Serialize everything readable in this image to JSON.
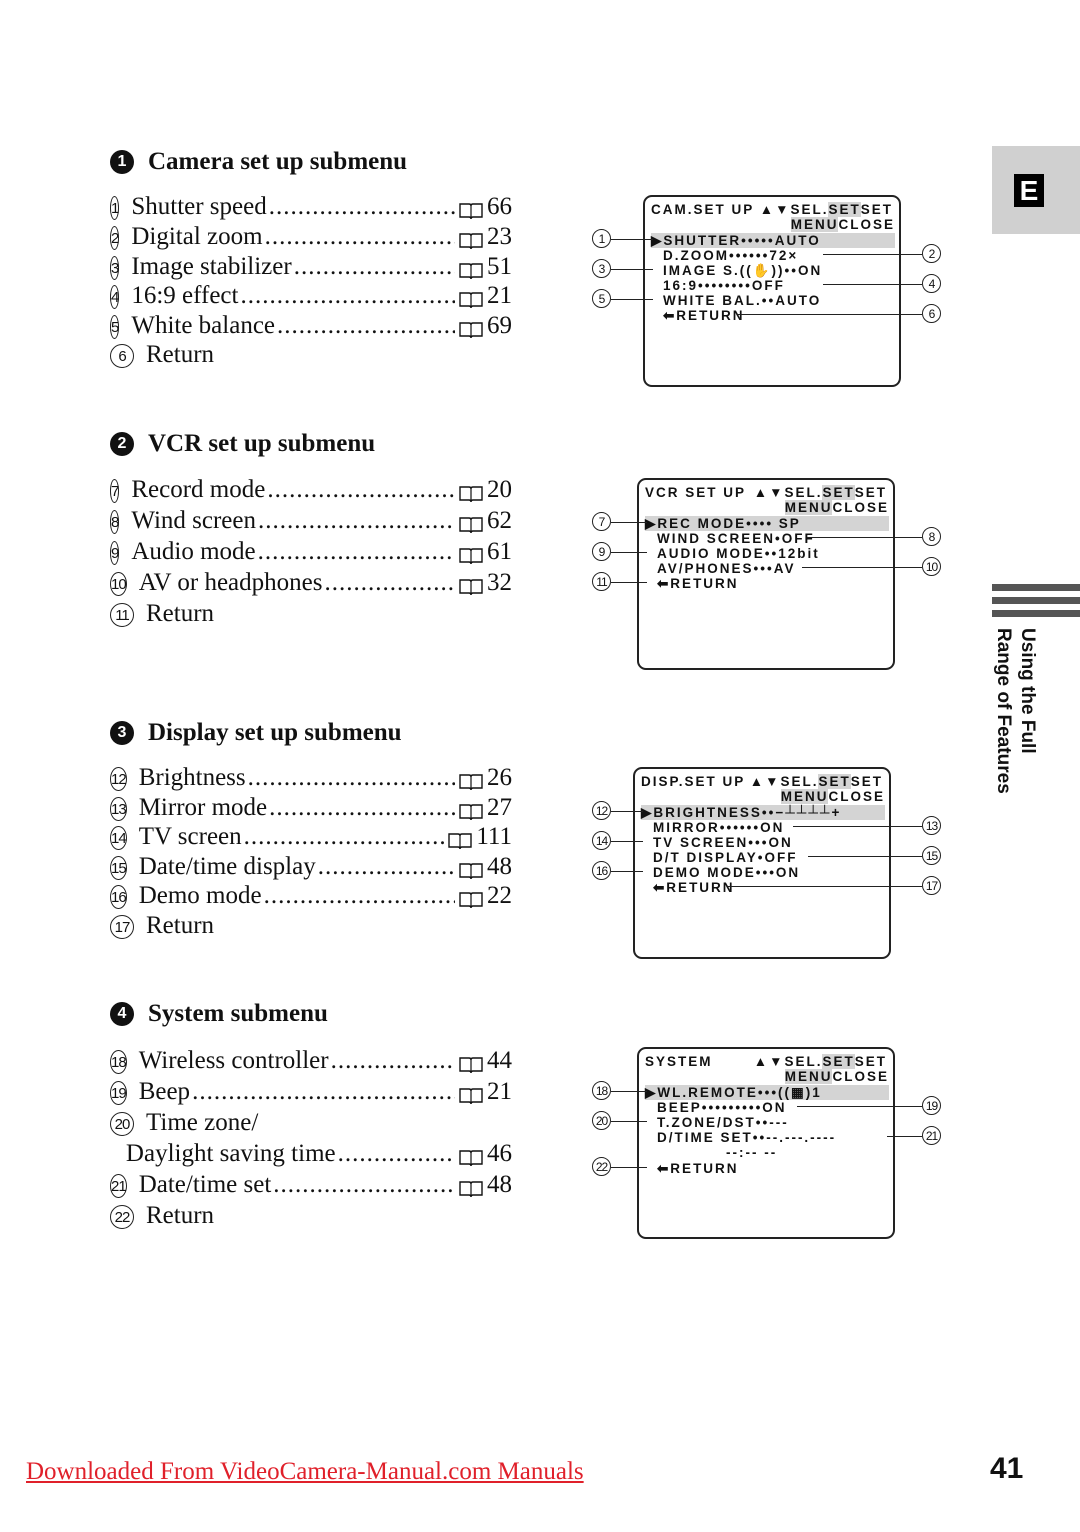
{
  "sections": [
    {
      "bullet": "1",
      "title": "Camera set up submenu",
      "items": [
        {
          "num": "1",
          "label": "Shutter speed",
          "page": "66"
        },
        {
          "num": "2",
          "label": "Digital zoom",
          "page": "23"
        },
        {
          "num": "3",
          "label": "Image stabilizer",
          "page": "51"
        },
        {
          "num": "4",
          "label": "16:9 effect",
          "page": "21"
        },
        {
          "num": "5",
          "label": "White balance",
          "page": "69"
        },
        {
          "num": "6",
          "label": "Return",
          "page": ""
        }
      ],
      "screen": {
        "title": "CAM.SET UP",
        "rows": [
          "▶SHUTTER•••••AUTO",
          "D.ZOOM••••••72×",
          "IMAGE S.((✋))••ON",
          "16:9••••••••OFF",
          "WHITE BAL.••AUTO",
          "⬅RETURN"
        ]
      }
    },
    {
      "bullet": "2",
      "title": "VCR set up submenu",
      "items": [
        {
          "num": "7",
          "label": "Record mode",
          "page": "20"
        },
        {
          "num": "8",
          "label": "Wind screen",
          "page": "62"
        },
        {
          "num": "9",
          "label": "Audio mode",
          "page": "61"
        },
        {
          "num": "10",
          "label": "AV or headphones",
          "page": "32"
        },
        {
          "num": "11",
          "label": "Return",
          "page": ""
        }
      ],
      "screen": {
        "title": "VCR SET UP",
        "rows": [
          "▶REC MODE•••• SP",
          "WIND SCREEN•OFF",
          "AUDIO MODE••12bit",
          "AV/PHONES•••AV",
          "⬅RETURN"
        ]
      }
    },
    {
      "bullet": "3",
      "title": "Display set up submenu",
      "items": [
        {
          "num": "12",
          "label": "Brightness",
          "page": "26"
        },
        {
          "num": "13",
          "label": "Mirror mode",
          "page": "27"
        },
        {
          "num": "14",
          "label": "TV screen",
          "page": "111"
        },
        {
          "num": "15",
          "label": "Date/time display",
          "page": "48"
        },
        {
          "num": "16",
          "label": "Demo mode",
          "page": "22"
        },
        {
          "num": "17",
          "label": "Return",
          "page": ""
        }
      ],
      "screen": {
        "title": "DISP.SET UP",
        "rows": [
          "▶BRIGHTNESS••−┴┴┴┴+",
          "MIRROR••••••ON",
          "TV SCREEN•••ON",
          "D/T DISPLAY•OFF",
          "DEMO MODE•••ON",
          "⬅RETURN"
        ]
      }
    },
    {
      "bullet": "4",
      "title": "System submenu",
      "items": [
        {
          "num": "18",
          "label": "Wireless controller",
          "page": "44"
        },
        {
          "num": "19",
          "label": "Beep",
          "page": "21"
        },
        {
          "num": "20",
          "label": "Time zone/",
          "page": ""
        },
        {
          "num": "",
          "label": "Daylight saving time",
          "page": "46"
        },
        {
          "num": "21",
          "label": "Date/time set",
          "page": "48"
        },
        {
          "num": "22",
          "label": "Return",
          "page": ""
        }
      ],
      "screen": {
        "title": "SYSTEM",
        "rows": [
          "▶WL.REMOTE•••((▦)1",
          "BEEP•••••••••ON",
          "T.ZONE/DST••---",
          "D/TIME SET••--.---.----",
          "            --:-- --",
          "⬅RETURN"
        ]
      }
    }
  ],
  "screen_common": {
    "sel": "▲▼SEL.",
    "set_key": "SET",
    "set_label": "SET",
    "menu_key": "MENU",
    "close_label": "CLOSE"
  },
  "side_tab": {
    "letter": "E",
    "line1": "Using the Full",
    "line2": "Range of Features"
  },
  "footer": {
    "link_text": "Downloaded From VideoCamera-Manual.com Manuals",
    "link_color": "#e0202a",
    "page_number": "41"
  }
}
